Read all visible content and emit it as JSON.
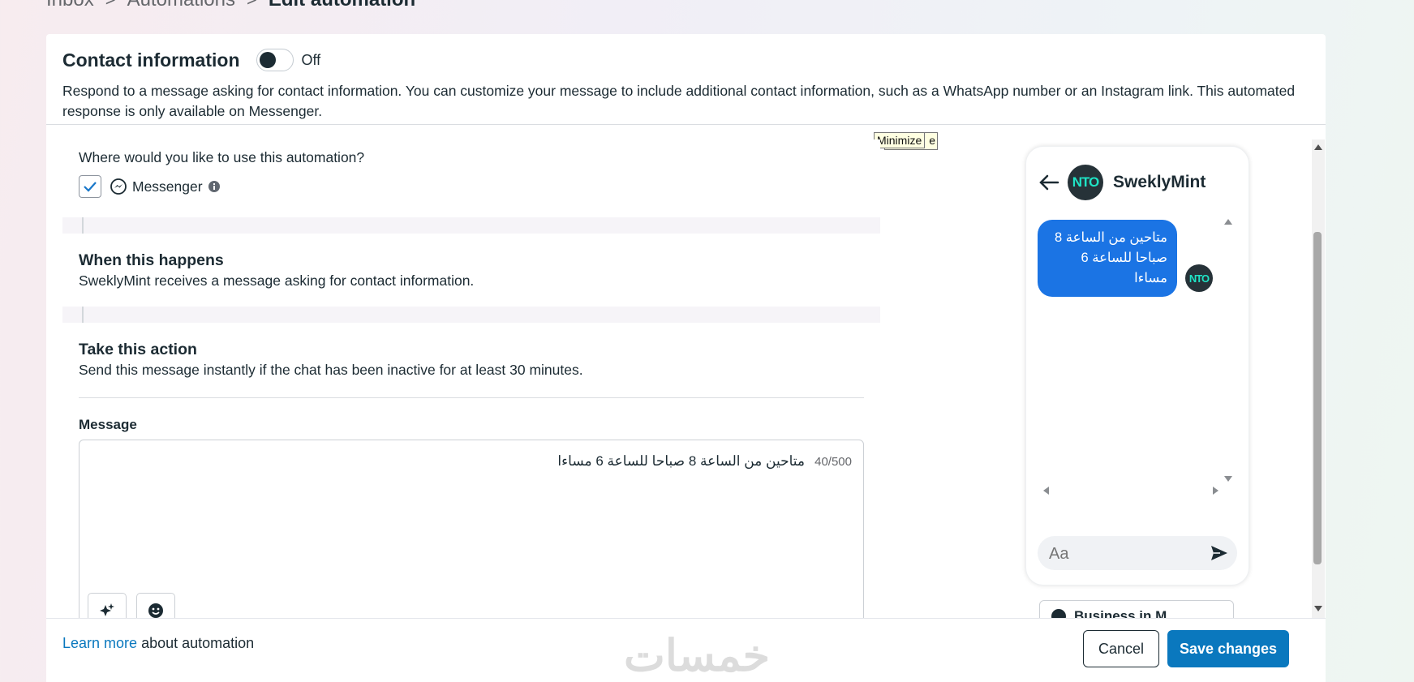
{
  "breadcrumb": {
    "items": [
      "Inbox",
      "Automations"
    ],
    "current": "Edit automation",
    "separator": ">"
  },
  "header": {
    "title": "Contact information",
    "toggle_label": "Off",
    "toggle_on": false,
    "description": "Respond to a message asking for contact information. You can customize your message to include additional contact information, such as a WhatsApp number or an Instagram link. This automated response is only available on Messenger."
  },
  "tooltip": {
    "text": "Minimize",
    "partial_behind": "e"
  },
  "where": {
    "question": "Where would you like to use this automation?",
    "channel_label": "Messenger",
    "checked": true
  },
  "trigger": {
    "heading": "When this happens",
    "text": "SweklyMint receives a message asking for contact information."
  },
  "action": {
    "heading": "Take this action",
    "text": "Send this message instantly if the chat has been inactive for at least 30 minutes.",
    "message_label": "Message",
    "message_text": "متاحين من الساعة 8  صباحا للساعة 6 مساءا",
    "counter": "40/500"
  },
  "preview": {
    "page_name": "SweklyMint",
    "avatar_text": "NTO",
    "bubble_text": "متاحين من الساعة 8  صباحا للساعة 6 مساءا",
    "composer_placeholder": "Aa",
    "business_button": "Business in M..."
  },
  "footer": {
    "learn_more_link": "Learn more",
    "learn_more_suffix": " about automation",
    "watermark": "خمسات",
    "cancel": "Cancel",
    "save": "Save changes"
  },
  "colors": {
    "primary": "#0a78be",
    "bubble": "#1b74e4",
    "text": "#1c2b33"
  }
}
